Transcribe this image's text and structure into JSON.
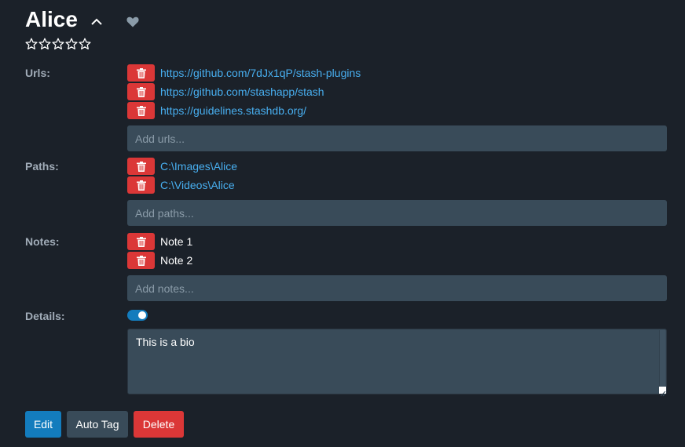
{
  "performer": {
    "name": "Alice",
    "rating_max": 5,
    "rating_value": 0
  },
  "colors": {
    "background": "#1b2129",
    "link": "#48aff0",
    "danger": "#db3737",
    "primary": "#137cbd",
    "input_bg": "#394b59",
    "label": "#a1acb8"
  },
  "icons": {
    "collapse": "chevron-up-icon",
    "favorite": "heart-icon",
    "rating": "star-outline-icon",
    "remove": "trash-icon"
  },
  "urls": {
    "label": "Urls:",
    "items": [
      "https://github.com/7dJx1qP/stash-plugins",
      "https://github.com/stashapp/stash",
      "https://guidelines.stashdb.org/"
    ],
    "placeholder": "Add urls..."
  },
  "paths": {
    "label": "Paths:",
    "items": [
      "C:\\Images\\Alice",
      "C:\\Videos\\Alice"
    ],
    "placeholder": "Add paths..."
  },
  "notes": {
    "label": "Notes:",
    "items": [
      "Note 1",
      "Note 2"
    ],
    "placeholder": "Add notes..."
  },
  "details": {
    "label": "Details:",
    "toggle_on": true,
    "value": "This is a bio"
  },
  "actions": {
    "edit": "Edit",
    "auto_tag": "Auto Tag",
    "delete": "Delete"
  }
}
